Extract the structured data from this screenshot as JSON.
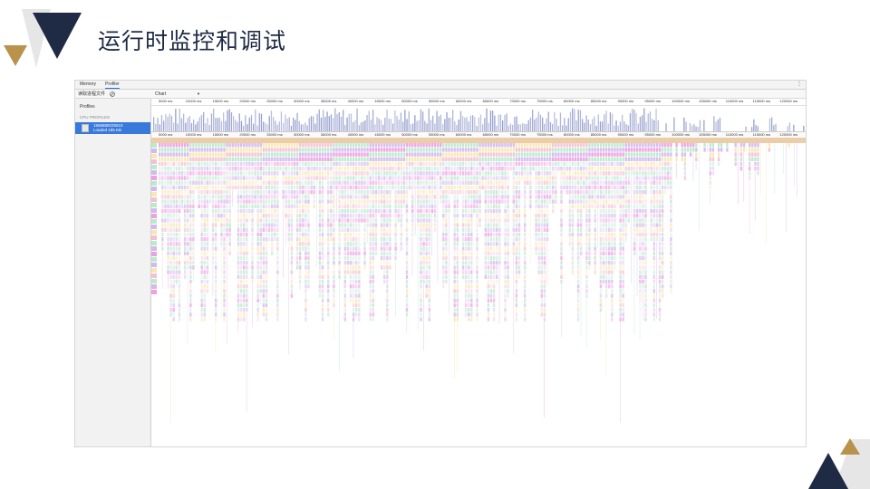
{
  "slide": {
    "title": "运行时监控和调试"
  },
  "devtools": {
    "tabs": [
      {
        "label": "Memory",
        "active": false
      },
      {
        "label": "Profiler",
        "active": true
      }
    ],
    "toolbar": {
      "load_label": "读取进程文件",
      "clear_icon": "clear-icon",
      "view_select_value": "Chart"
    },
    "sidebar": {
      "heading": "Profiles",
      "section_label": "CPU PROFILES",
      "profile_name": "1566889225510",
      "profile_size": "Loaded 185 KB"
    },
    "overview_ticks": [
      "5000 ms",
      "10000 ms",
      "15000 ms",
      "20000 ms",
      "25000 ms",
      "30000 ms",
      "35000 ms",
      "40000 ms",
      "45000 ms",
      "50000 ms",
      "55000 ms",
      "60000 ms",
      "65000 ms",
      "70000 ms",
      "75000 ms",
      "80000 ms",
      "85000 ms",
      "90000 ms",
      "95000 ms",
      "100000 ms",
      "105000 ms",
      "110000 ms",
      "115000 ms",
      "120000 ms"
    ],
    "flame_ticks": [
      "5000 ms",
      "10000 ms",
      "15000 ms",
      "20000 ms",
      "25000 ms",
      "30000 ms",
      "35000 ms",
      "40000 ms",
      "45000 ms",
      "50000 ms",
      "55000 ms",
      "60000 ms",
      "65000 ms",
      "70000 ms",
      "75000 ms",
      "80000 ms",
      "85000 ms",
      "90000 ms",
      "95000 ms",
      "100000 ms",
      "105000 ms",
      "110000 ms",
      "115000 ms",
      "120000 ms"
    ],
    "colors": {
      "selected": "#3879d9",
      "overview_bar": "#8d96c8",
      "root_bar": "#e9c49a",
      "magenta": "#e98ad9",
      "green": "#a9e4c0",
      "purple": "#c9a8e8",
      "yellow": "#f1e3a0",
      "pink": "#f3b0c8"
    }
  }
}
